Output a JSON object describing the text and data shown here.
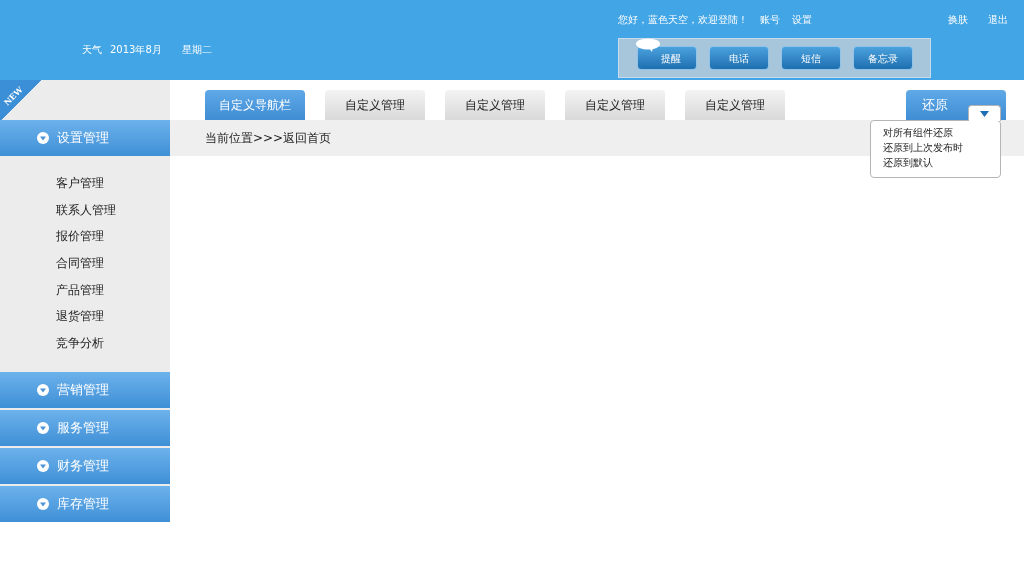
{
  "header": {
    "weather": "天气",
    "date": "2013年8月",
    "weekday": "星期二",
    "greeting": "您好，蓝色天空，欢迎登陆！",
    "links": [
      "账号",
      "设置"
    ],
    "right_links": [
      "换肤",
      "退出"
    ],
    "quick_buttons": [
      {
        "label": "提醒",
        "badge": true
      },
      {
        "label": "电话",
        "badge": false
      },
      {
        "label": "短信",
        "badge": false
      },
      {
        "label": "备忘录",
        "badge": false
      }
    ]
  },
  "corner_ribbon": "NEW",
  "sidebar": [
    {
      "label": "设置管理",
      "children": [
        "客户管理",
        "联系人管理",
        "报价管理",
        "合同管理",
        "产品管理",
        "退货管理",
        "竞争分析"
      ]
    },
    {
      "label": "营销管理"
    },
    {
      "label": "服务管理"
    },
    {
      "label": "财务管理"
    },
    {
      "label": "库存管理"
    }
  ],
  "tabs": [
    {
      "label": "自定义导航栏",
      "selected": true
    },
    {
      "label": "自定义管理",
      "selected": false
    },
    {
      "label": "自定义管理",
      "selected": false
    },
    {
      "label": "自定义管理",
      "selected": false
    },
    {
      "label": "自定义管理",
      "selected": false
    }
  ],
  "restore": {
    "label": "还原",
    "open": true,
    "items": [
      "对所有组件还原",
      "还原到上次发布时",
      "还原到默认"
    ]
  },
  "breadcrumb": "当前位置>>>返回首页"
}
